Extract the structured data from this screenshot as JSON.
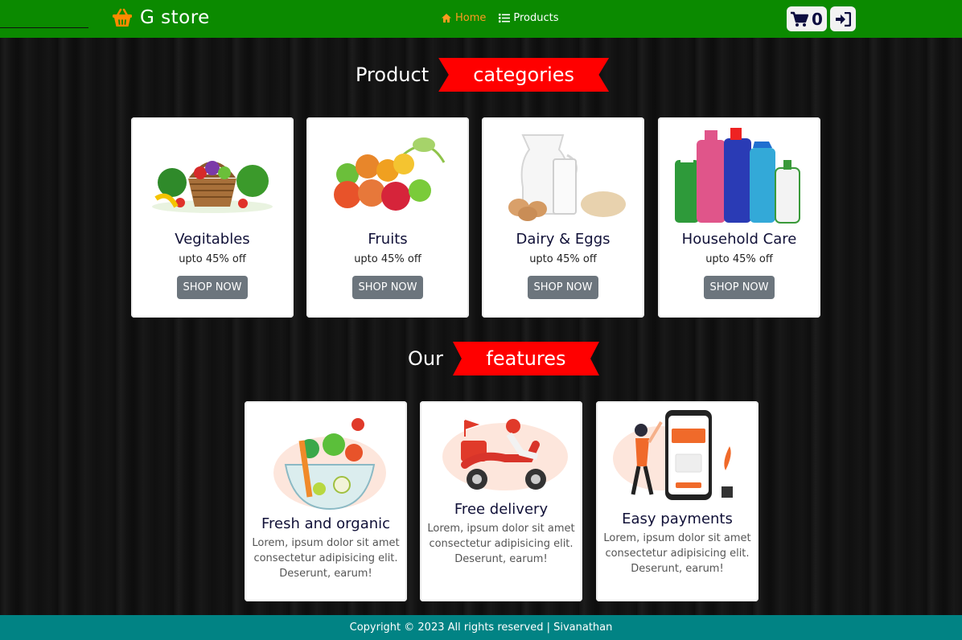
{
  "navbar": {
    "brand": "G store",
    "links": [
      {
        "label": "Home",
        "icon": "home-icon",
        "active": true
      },
      {
        "label": "Products",
        "icon": "list-icon",
        "active": false
      }
    ],
    "cart_count": "0",
    "colors": {
      "background": "#0b8a00",
      "active_link": "#ff9a1f"
    }
  },
  "categories_section": {
    "heading_plain": "Product",
    "heading_highlight": "categories",
    "cards": [
      {
        "title": "Vegitables",
        "subtitle": "upto 45% off",
        "button": "SHOP NOW"
      },
      {
        "title": "Fruits",
        "subtitle": "upto 45% off",
        "button": "SHOP NOW"
      },
      {
        "title": "Dairy & Eggs",
        "subtitle": "upto 45% off",
        "button": "SHOP NOW"
      },
      {
        "title": "Household Care",
        "subtitle": "upto 45% off",
        "button": "SHOP NOW"
      }
    ]
  },
  "features_section": {
    "heading_plain": "Our",
    "heading_highlight": "features",
    "cards": [
      {
        "title": "Fresh and organic",
        "text": "Lorem, ipsum dolor sit amet consectetur adipisicing elit. Deserunt, earum!"
      },
      {
        "title": "Free delivery",
        "text": "Lorem, ipsum dolor sit amet consectetur adipisicing elit. Deserunt, earum!"
      },
      {
        "title": "Easy payments",
        "text": "Lorem, ipsum dolor sit amet consectetur adipisicing elit. Deserunt, earum!"
      }
    ]
  },
  "footer": {
    "text": "Copyright © 2023 All rights reserved | Sivanathan",
    "color": "#018384"
  },
  "accent_color": "#ff0000"
}
